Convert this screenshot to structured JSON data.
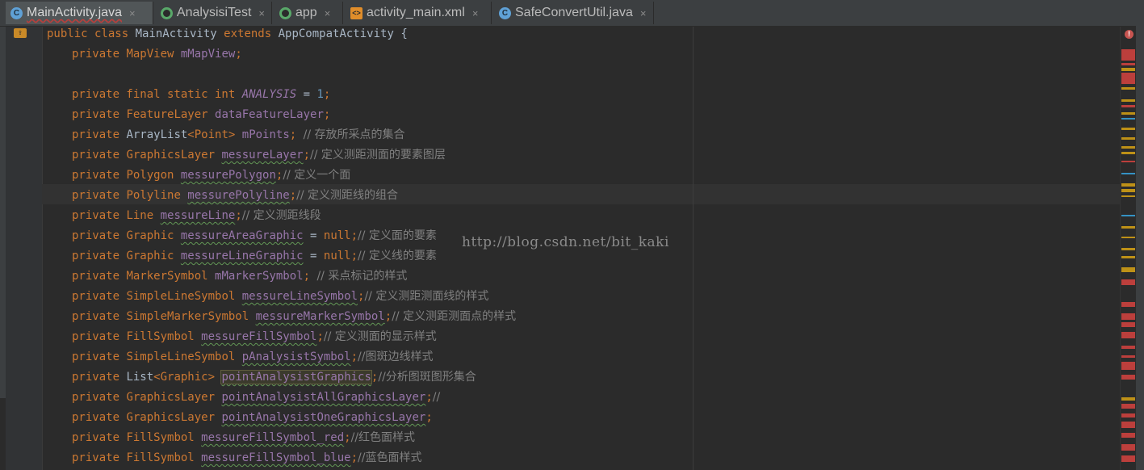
{
  "tabs": [
    {
      "label": "MainActivity.java",
      "icon": "java-class-icon",
      "active": true
    },
    {
      "label": "AnalysisiTest",
      "icon": "test-run-icon",
      "active": false
    },
    {
      "label": "app",
      "icon": "android-module-icon",
      "active": false
    },
    {
      "label": "activity_main.xml",
      "icon": "xml-file-icon",
      "active": false
    },
    {
      "label": "SafeConvertUtil.java",
      "icon": "java-class-icon",
      "active": false
    }
  ],
  "tab_close_glyph": "×",
  "editor": {
    "class_header": {
      "kw": "public class ",
      "name": "MainActivity ",
      "ext": "extends ",
      "parent": "AppCompatActivity ",
      "brace": "{"
    },
    "lines": [
      {
        "mod": "private ",
        "type": "MapView ",
        "name": "mMapView",
        "end": ";",
        "comment": ""
      },
      {
        "mod": "private final static int ",
        "type": "",
        "name": "ANALYSIS",
        "end": " = ",
        "num": "1",
        "end2": ";",
        "comment": ""
      },
      {
        "mod": "private ",
        "type": "FeatureLayer ",
        "name": "dataFeatureLayer",
        "end": ";",
        "comment": ""
      },
      {
        "mod": "private ",
        "type": "ArrayList<Point> ",
        "name": "mPoints",
        "end": "; ",
        "comment": "// 存放所采点的集合"
      },
      {
        "mod": "private ",
        "type": "GraphicsLayer ",
        "name": "messureLayer",
        "end": ";",
        "comment": "// 定义测距测面的要素图层"
      },
      {
        "mod": "private ",
        "type": "Polygon ",
        "name": "messurePolygon",
        "end": ";",
        "comment": "// 定义一个面"
      },
      {
        "mod": "private ",
        "type": "Polyline ",
        "name": "messurePolyline",
        "end": ";",
        "comment": "// 定义测距线的组合"
      },
      {
        "mod": "private ",
        "type": "Line ",
        "name": "messureLine",
        "end": ";",
        "comment": "// 定义测距线段"
      },
      {
        "mod": "private ",
        "type": "Graphic ",
        "name": "messureAreaGraphic",
        "end": " = null;",
        "comment": "// 定义面的要素"
      },
      {
        "mod": "private ",
        "type": "Graphic ",
        "name": "messureLineGraphic",
        "end": " = null;",
        "comment": "// 定义线的要素"
      },
      {
        "mod": "private ",
        "type": "MarkerSymbol ",
        "name": "mMarkerSymbol",
        "end": "; ",
        "comment": "// 采点标记的样式"
      },
      {
        "mod": "private ",
        "type": "SimpleLineSymbol ",
        "name": "messureLineSymbol",
        "end": ";",
        "comment": "// 定义测距测面线的样式"
      },
      {
        "mod": "private ",
        "type": "SimpleMarkerSymbol ",
        "name": "messureMarkerSymbol",
        "end": ";",
        "comment": "// 定义测距测面点的样式"
      },
      {
        "mod": "private ",
        "type": "FillSymbol ",
        "name": "messureFillSymbol",
        "end": ";",
        "comment": "// 定义测面的显示样式"
      },
      {
        "mod": "private ",
        "type": "SimpleLineSymbol ",
        "name": "pAnalysistSymbol",
        "end": ";",
        "comment": "//图斑边线样式"
      },
      {
        "mod": "private ",
        "type": "List<Graphic> ",
        "name": "pointAnalysistGraphics",
        "end": ";",
        "comment": "//分析图斑图形集合"
      },
      {
        "mod": "private ",
        "type": "GraphicsLayer ",
        "name": "pointAnalysistAllGraphicsLayer",
        "end": ";",
        "comment": "//"
      },
      {
        "mod": "private ",
        "type": "GraphicsLayer ",
        "name": "pointAnalysistOneGraphicsLayer",
        "end": ";",
        "comment": ""
      },
      {
        "mod": "private ",
        "type": "FillSymbol ",
        "name": "messureFillSymbol_red",
        "end": ";",
        "comment": "//红色面样式"
      },
      {
        "mod": "private ",
        "type": "FillSymbol ",
        "name": "messureFillSymbol_blue",
        "end": ";",
        "comment": "//蓝色面样式"
      }
    ]
  },
  "watermark": "http://blog.csdn.net/bit_kaki",
  "error_indicator": "!",
  "colors": {
    "background": "#2b2b2b",
    "keyword": "#cc7832",
    "text": "#a9b7c6",
    "comment": "#808080",
    "error_stripe": "#bc3f3c",
    "warning_stripe": "#be9117"
  }
}
